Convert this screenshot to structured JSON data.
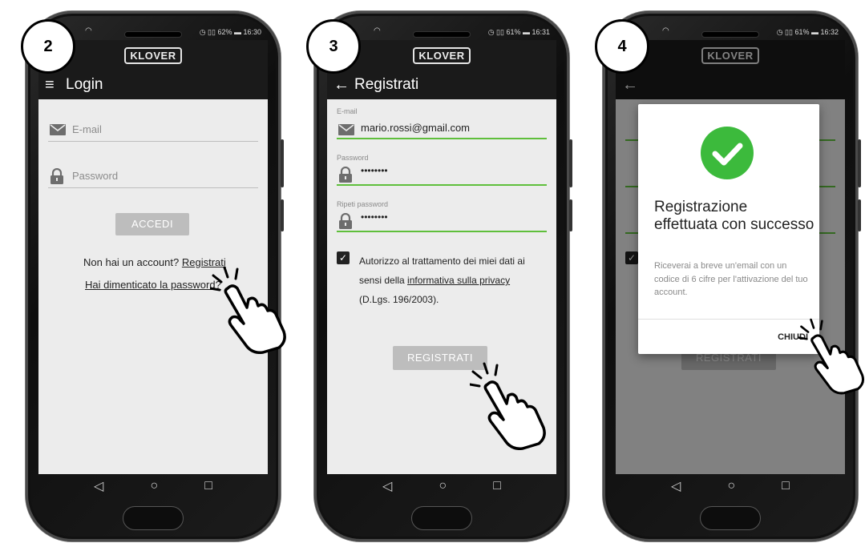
{
  "brand": "KLOVER",
  "nav_buttons": {
    "back": "◁",
    "home": "○",
    "recents": "□"
  },
  "screens": [
    {
      "step": "2",
      "status": "◷ ▯▯ 62% ▬ 16:30",
      "appbar_title": "Login",
      "appbar_icon": "menu-icon",
      "email_placeholder": "E-mail",
      "password_placeholder": "Password",
      "login_button": "ACCEDI",
      "no_account_text": "Non hai un account? ",
      "register_link": "Registrati",
      "forgot_link": "Hai dimenticato la password?"
    },
    {
      "step": "3",
      "status": "◷ ▯▯ 61% ▬ 16:31",
      "appbar_title": "Registrati",
      "appbar_icon": "back-arrow-icon",
      "email_label": "E-mail",
      "email_value": "mario.rossi@gmail.com",
      "password_label": "Password",
      "password_value": "••••••••",
      "repeat_label": "Ripeti password",
      "repeat_value": "••••••••",
      "consent_1": "Autorizzo al trattamento dei miei dati ai",
      "consent_2": "sensi della ",
      "privacy_link": "informativa sulla privacy",
      "consent_3": "(D.Lgs. 196/2003).",
      "register_button": "REGISTRATI"
    },
    {
      "step": "4",
      "status": "◷ ▯▯ 61% ▬ 16:32",
      "dialog_title": "Registrazione effettuata con successo",
      "dialog_body": "Riceverai a breve un'email con un codice di 6 cifre per l'attivazione del tuo account.",
      "dialog_close": "CHIUDI",
      "register_button": "REGISTRATI"
    }
  ],
  "colors": {
    "accent_green": "#5fbf3c",
    "success_green": "#3cba3c",
    "appbar": "#1a1a1a",
    "content_bg": "#ececec"
  }
}
